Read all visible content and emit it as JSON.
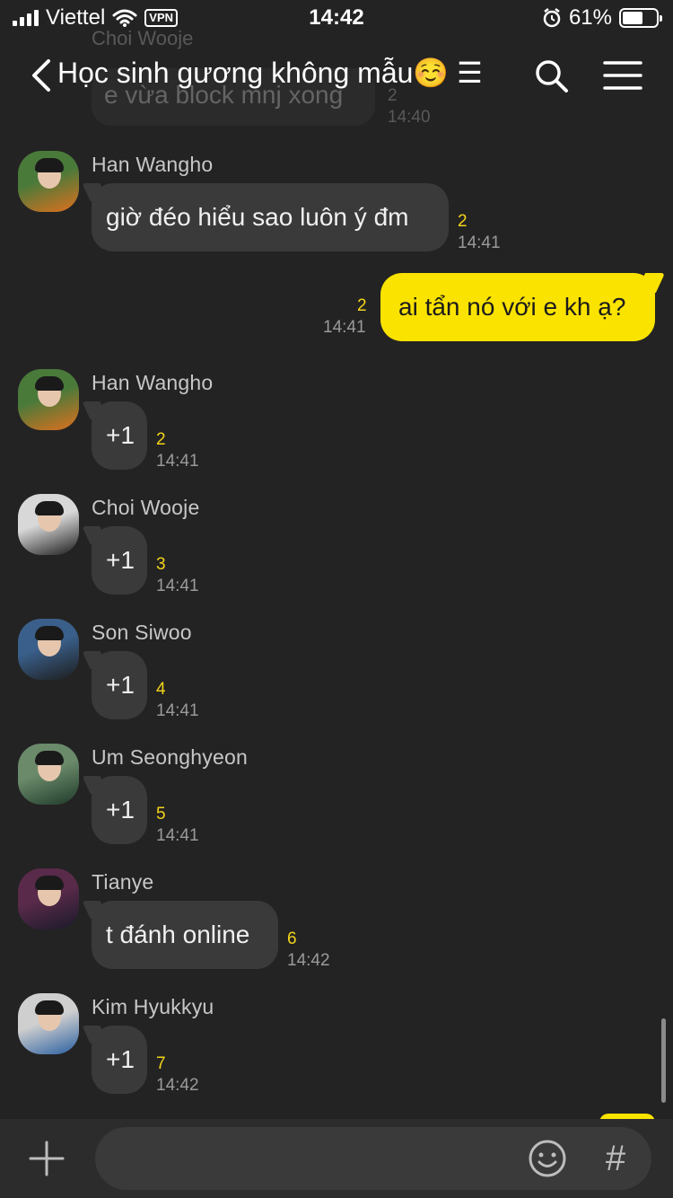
{
  "status": {
    "carrier": "Viettel",
    "vpn": "VPN",
    "time": "14:42",
    "battery": "61%",
    "battery_level": 0.61
  },
  "header": {
    "title": "Học sinh gương không mẫu☺️ ☰"
  },
  "ghost": {
    "sender": "Choi Wooje",
    "text": "e vừa block mnj xong",
    "unread": "2",
    "time": "14:40"
  },
  "messages": [
    {
      "sender": "Han Wangho",
      "text": "giờ đéo hiểu sao luôn ý đm",
      "unread": "2",
      "time": "14:41",
      "avatar_colors": [
        "#4a7a3a",
        "#e0701e"
      ]
    },
    {
      "mine": true,
      "text": "ai tẩn nó với e kh ạ?",
      "unread": "2",
      "time": "14:41"
    },
    {
      "sender": "Han Wangho",
      "text": "+1",
      "unread": "2",
      "time": "14:41",
      "avatar_colors": [
        "#4a7a3a",
        "#e0701e"
      ]
    },
    {
      "sender": "Choi Wooje",
      "text": "+1",
      "unread": "3",
      "time": "14:41",
      "avatar_colors": [
        "#d8d8d8",
        "#1b1b1b"
      ]
    },
    {
      "sender": "Son Siwoo",
      "text": "+1",
      "unread": "4",
      "time": "14:41",
      "avatar_colors": [
        "#3a5f8a",
        "#1d1d1d"
      ]
    },
    {
      "sender": "Um Seonghyeon",
      "text": "+1",
      "unread": "5",
      "time": "14:41",
      "avatar_colors": [
        "#6a8a6a",
        "#1f3a2a"
      ]
    },
    {
      "sender": "Tianye",
      "text": "t đánh online",
      "unread": "6",
      "time": "14:42",
      "avatar_colors": [
        "#5a2a4a",
        "#1a1a2a"
      ]
    },
    {
      "sender": "Kim Hyukkyu",
      "text": "+1",
      "unread": "7",
      "time": "14:42",
      "avatar_colors": [
        "#cfcfcf",
        "#2a5fa0"
      ]
    }
  ],
  "input": {
    "placeholder": "",
    "value": ""
  },
  "icons": {
    "back": "chevron-left-icon",
    "search": "search-icon",
    "menu": "menu-icon",
    "plus": "plus-icon",
    "emoji": "emoji-icon",
    "hash": "#"
  },
  "colors": {
    "background": "#232323",
    "bubble_other": "#3a3a3a",
    "bubble_mine": "#fbe300",
    "unread": "#f4d41a"
  }
}
